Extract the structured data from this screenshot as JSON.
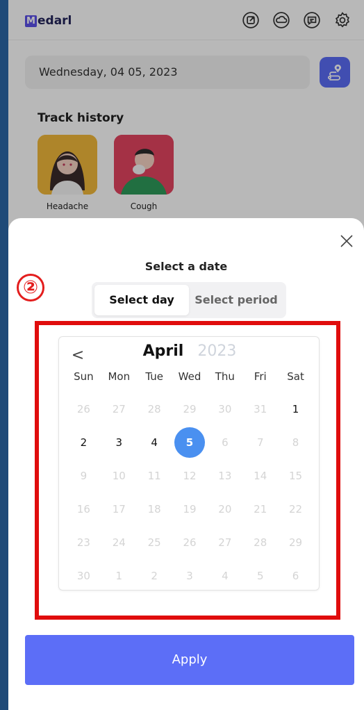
{
  "app": {
    "logo_mark": "M",
    "logo_rest": "edarl"
  },
  "header_icons": [
    "share-icon",
    "cloud-icon",
    "message-icon",
    "settings-icon"
  ],
  "date_bar": {
    "value": "Wednesday, 04 05, 2023"
  },
  "track_history": {
    "title": "Track history",
    "items": [
      {
        "label": "Headache",
        "color": "#f2b93b"
      },
      {
        "label": "Cough",
        "color": "#e44560"
      }
    ]
  },
  "sheet": {
    "title": "Select a date",
    "step_marker": "②",
    "tabs": [
      {
        "label": "Select day",
        "active": true
      },
      {
        "label": "Select period",
        "active": false
      }
    ],
    "apply_label": "Apply"
  },
  "calendar": {
    "month": "April",
    "year": "2023",
    "prev_symbol": "<",
    "weekdays": [
      "Sun",
      "Mon",
      "Tue",
      "Wed",
      "Thu",
      "Fri",
      "Sat"
    ],
    "days": [
      {
        "d": "26",
        "s": "out"
      },
      {
        "d": "27",
        "s": "out"
      },
      {
        "d": "28",
        "s": "out"
      },
      {
        "d": "29",
        "s": "out"
      },
      {
        "d": "30",
        "s": "out"
      },
      {
        "d": "31",
        "s": "out"
      },
      {
        "d": "1",
        "s": "cur"
      },
      {
        "d": "2",
        "s": "cur"
      },
      {
        "d": "3",
        "s": "cur"
      },
      {
        "d": "4",
        "s": "cur"
      },
      {
        "d": "5",
        "s": "sel"
      },
      {
        "d": "6",
        "s": "dis"
      },
      {
        "d": "7",
        "s": "dis"
      },
      {
        "d": "8",
        "s": "dis"
      },
      {
        "d": "9",
        "s": "dis"
      },
      {
        "d": "10",
        "s": "dis"
      },
      {
        "d": "11",
        "s": "dis"
      },
      {
        "d": "12",
        "s": "dis"
      },
      {
        "d": "13",
        "s": "dis"
      },
      {
        "d": "14",
        "s": "dis"
      },
      {
        "d": "15",
        "s": "dis"
      },
      {
        "d": "16",
        "s": "dis"
      },
      {
        "d": "17",
        "s": "dis"
      },
      {
        "d": "18",
        "s": "dis"
      },
      {
        "d": "19",
        "s": "dis"
      },
      {
        "d": "20",
        "s": "dis"
      },
      {
        "d": "21",
        "s": "dis"
      },
      {
        "d": "22",
        "s": "dis"
      },
      {
        "d": "23",
        "s": "dis"
      },
      {
        "d": "24",
        "s": "dis"
      },
      {
        "d": "25",
        "s": "dis"
      },
      {
        "d": "26",
        "s": "dis"
      },
      {
        "d": "27",
        "s": "dis"
      },
      {
        "d": "28",
        "s": "dis"
      },
      {
        "d": "29",
        "s": "dis"
      },
      {
        "d": "30",
        "s": "dis"
      },
      {
        "d": "1",
        "s": "out"
      },
      {
        "d": "2",
        "s": "out"
      },
      {
        "d": "3",
        "s": "out"
      },
      {
        "d": "4",
        "s": "out"
      },
      {
        "d": "5",
        "s": "out"
      },
      {
        "d": "6",
        "s": "out"
      }
    ]
  },
  "colors": {
    "accent": "#5c6ef7",
    "selected": "#4a90f0",
    "highlight": "#e00d0d"
  }
}
